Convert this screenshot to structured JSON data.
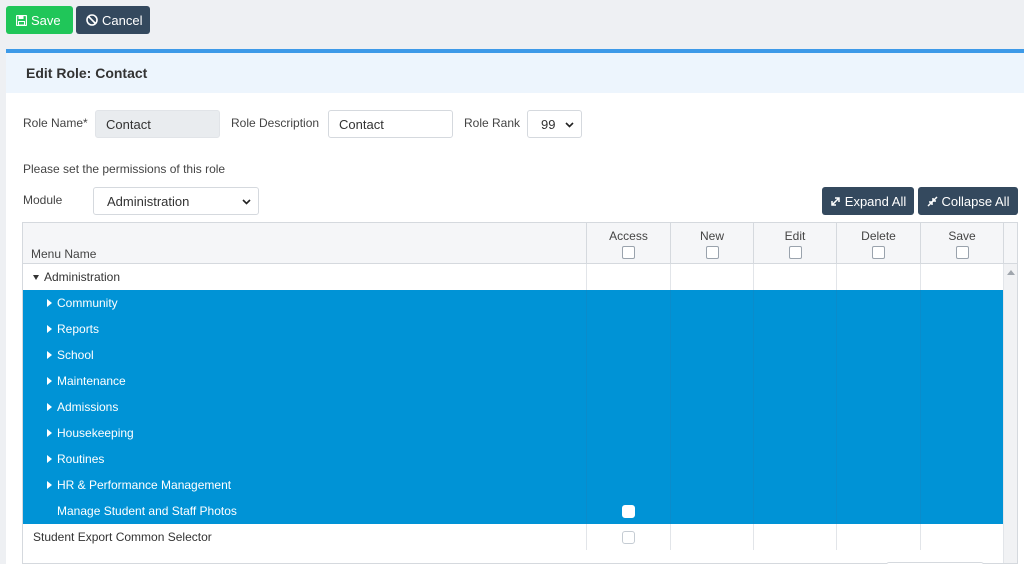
{
  "toolbar": {
    "save_label": "Save",
    "cancel_label": "Cancel"
  },
  "header": {
    "title": "Edit Role: Contact"
  },
  "form": {
    "role_name_label": "Role Name*",
    "role_name_value": "Contact",
    "role_description_label": "Role Description",
    "role_description_value": "Contact",
    "role_rank_label": "Role Rank",
    "role_rank_value": "99",
    "instructions": "Please set the permissions of this role",
    "module_label": "Module",
    "module_value": "Administration"
  },
  "actions": {
    "expand_all": "Expand All",
    "collapse_all": "Collapse All"
  },
  "grid": {
    "columns": {
      "menu_name": "Menu Name",
      "access": "Access",
      "new": "New",
      "edit": "Edit",
      "delete": "Delete",
      "save": "Save"
    },
    "rows": [
      {
        "label": "Administration",
        "expanded": true,
        "selected": false
      },
      {
        "label": "Community",
        "expanded": false,
        "selected": true
      },
      {
        "label": "Reports",
        "expanded": false,
        "selected": true
      },
      {
        "label": "School",
        "expanded": false,
        "selected": true
      },
      {
        "label": "Maintenance",
        "expanded": false,
        "selected": true
      },
      {
        "label": "Admissions",
        "expanded": false,
        "selected": true
      },
      {
        "label": "Housekeeping",
        "expanded": false,
        "selected": true
      },
      {
        "label": "Routines",
        "expanded": false,
        "selected": true
      },
      {
        "label": "HR & Performance Management",
        "expanded": false,
        "selected": true
      },
      {
        "label": "Manage Student and Staff Photos",
        "selected": true,
        "leaf": true,
        "access": false
      },
      {
        "label": "Student Export Common Selector",
        "selected": false,
        "leaf": true,
        "access": false
      }
    ]
  },
  "colors": {
    "save": "#20c659",
    "dark": "#34495e",
    "selection": "#0093d6",
    "accent": "#3d9ae8"
  }
}
